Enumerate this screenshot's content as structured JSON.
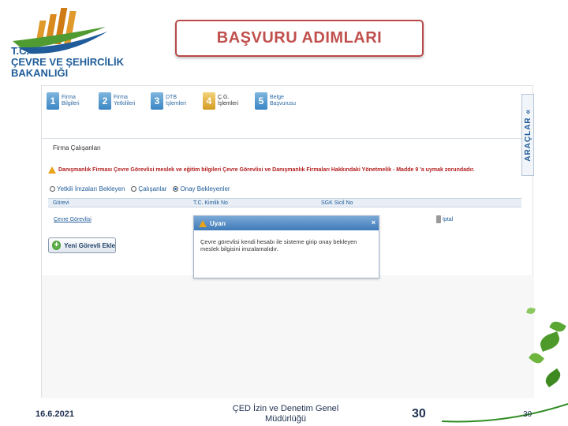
{
  "logo": {
    "line1": "T.C.",
    "line2": "ÇEVRE VE ŞEHİRCİLİK",
    "line3": "BAKANLIĞI"
  },
  "title": "BAŞVURU ADIMLARI",
  "steps": [
    {
      "num": "1",
      "label": "Firma Bilgileri"
    },
    {
      "num": "2",
      "label": "Firma Yetkilileri"
    },
    {
      "num": "3",
      "label": "DTB İşlemleri"
    },
    {
      "num": "4",
      "label": "Ç.G. İşlemleri"
    },
    {
      "num": "5",
      "label": "Belge Başvurusu"
    }
  ],
  "tools_tab": "ARAÇLAR «",
  "section_title": "Firma Çalışanları",
  "warning_text": "Danışmanlık Firması Çevre Görevlisi meslek ve eğitim bilgileri Çevre Görevlisi ve Danışmanlık Firmaları Hakkındaki Yönetmelik - Madde 9 'a uymak zorundadır.",
  "radios": [
    {
      "label": "Yetkili İmzaları Bekleyen",
      "checked": false
    },
    {
      "label": "Çalışanlar",
      "checked": false
    },
    {
      "label": "Onay Bekleyenler",
      "checked": true
    }
  ],
  "table": {
    "headers": [
      "Görevi",
      "T.C. Kimlik No",
      "SGK Sicil No"
    ],
    "row_link": "Çevre Görevlisi",
    "cancel_label": "İptal"
  },
  "add_button": "Yeni Görevli Ekle",
  "modal": {
    "title": "Uyarı",
    "close": "×",
    "body": "Çevre görevlisi kendi hesabı ile sisteme girip onay bekleyen meslek bilgisini imzalamalıdır."
  },
  "footer": {
    "date": "16.6.2021",
    "center": "ÇED İzin ve Denetim Genel Müdürlüğü",
    "page": "30",
    "page_small": "30"
  },
  "colors": {
    "brand_blue": "#1f5c99",
    "title_red": "#c0504d",
    "warning_red": "#b31d1d",
    "leaf_green": "#4d9a2a"
  }
}
